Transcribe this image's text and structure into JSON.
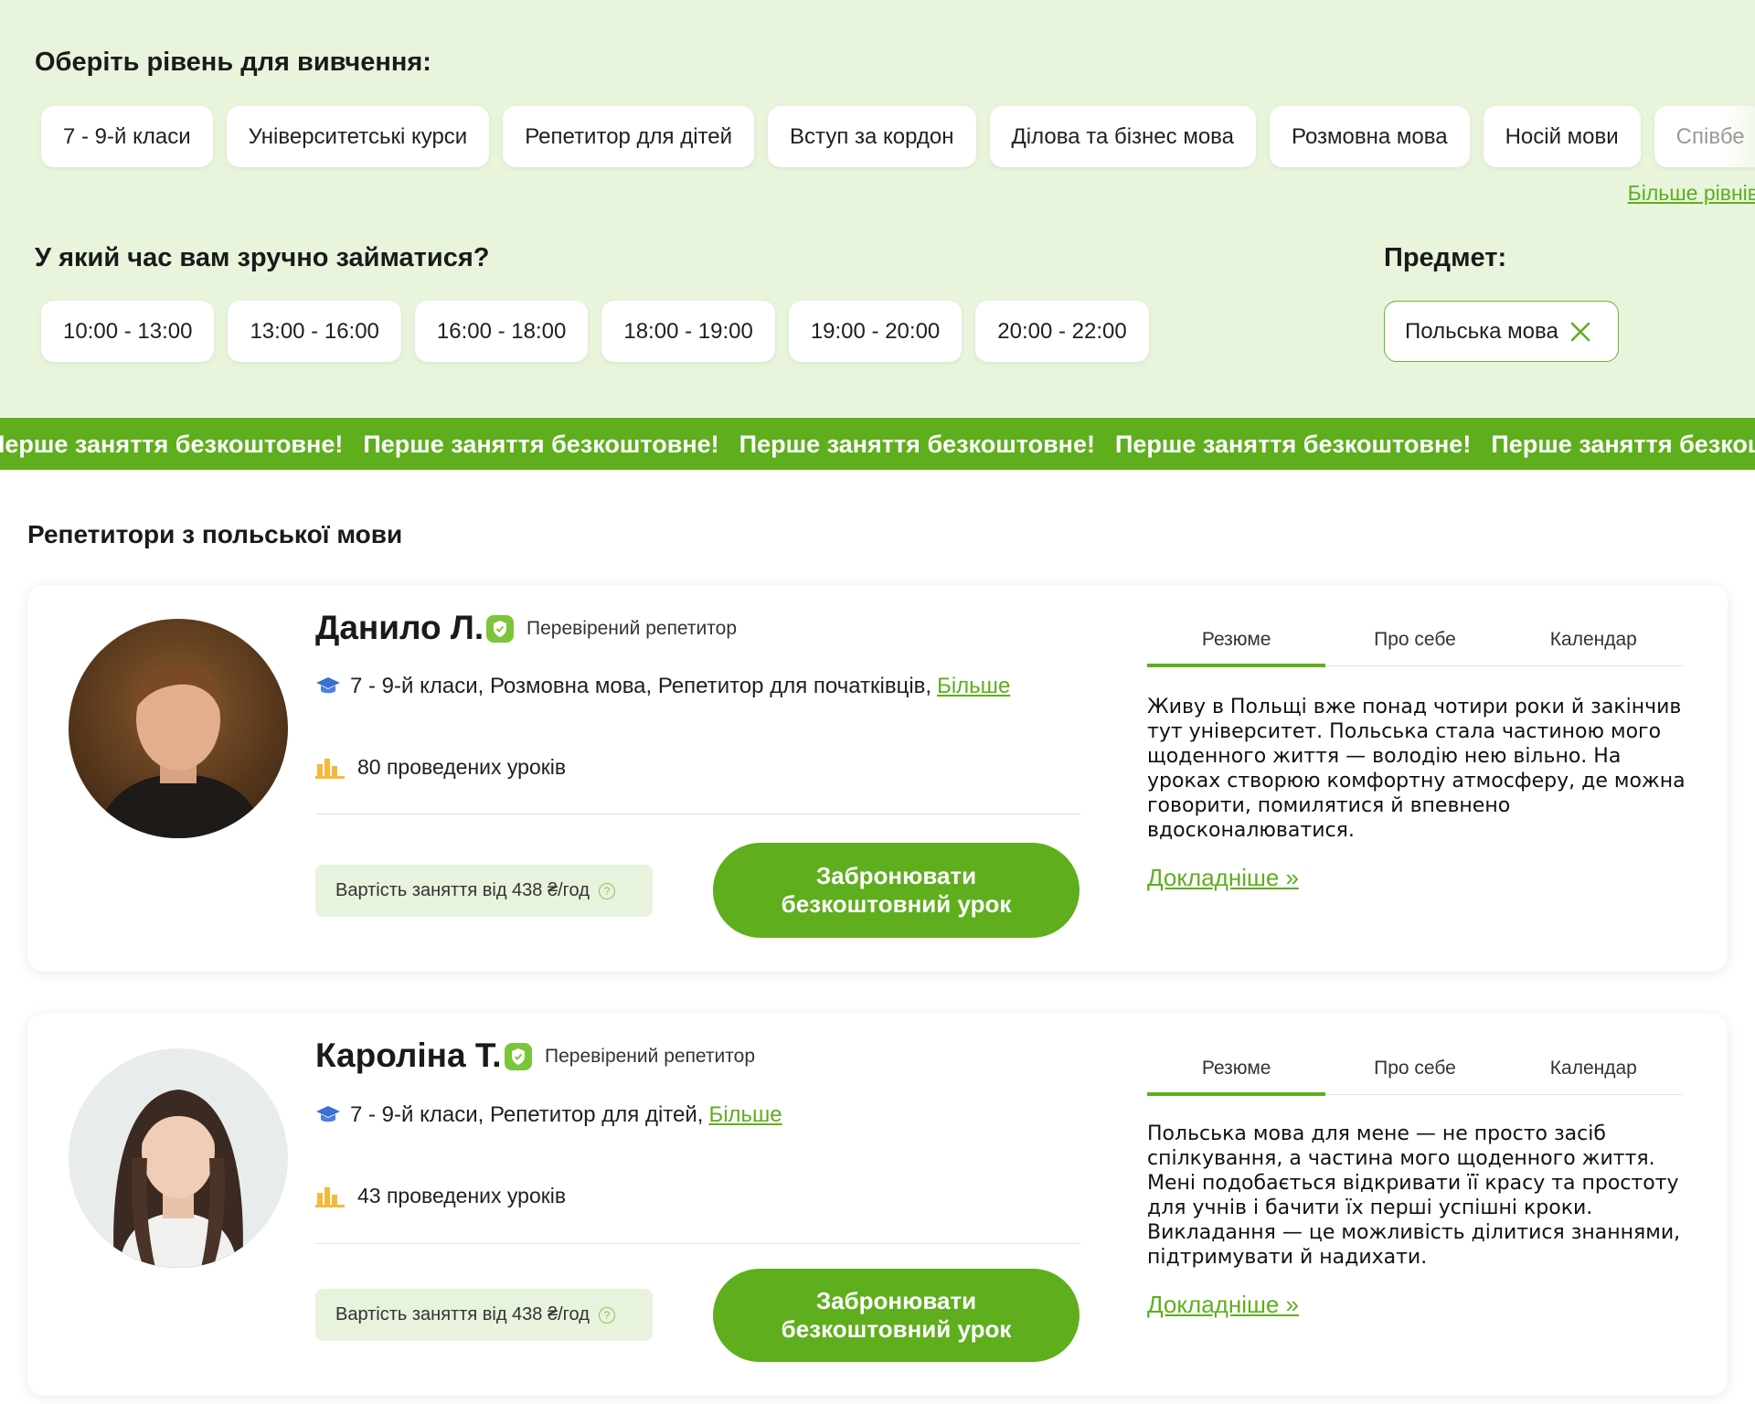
{
  "filters": {
    "level_heading": "Оберіть рівень для вивчення:",
    "levels": [
      "7 - 9-й класи",
      "Університетські курси",
      "Репетитор для дітей",
      "Вступ за кордон",
      "Ділова та бізнес мова",
      "Розмовна мова",
      "Носій мови",
      "Співбе"
    ],
    "more_levels": "Більше рівнів",
    "time_heading": "У який час вам зручно займатися?",
    "times": [
      "10:00 - 13:00",
      "13:00 - 16:00",
      "16:00 - 18:00",
      "18:00 - 19:00",
      "19:00 - 20:00",
      "20:00 - 22:00"
    ],
    "subject_heading": "Предмет:",
    "subject_value": "Польська мова"
  },
  "banner": {
    "items": [
      "Перше заняття безкоштовне!",
      "Перше заняття безкоштовне!",
      "Перше заняття безкоштовне!",
      "Перше заняття безкоштовне!",
      "Перше заняття безкоштовне!"
    ]
  },
  "section_title": "Репетитори з польської мови",
  "tutors": [
    {
      "name": "Данило Л.",
      "verified": "Перевірений репетитор",
      "levels": "7 - 9-й класи, Розмовна мова, Репетитор для початківців,",
      "more": "Більше",
      "lessons": "80 проведених уроків",
      "price": "Вартість заняття від 438 ₴/год",
      "book": "Забронювати безкоштовний урок",
      "tabs": [
        "Резюме",
        "Про себе",
        "Календар"
      ],
      "about": "Живу в Польщі вже понад чотири роки й закінчив тут університет. Польська стала частиною мого щоденного життя — володію нею вільно. На уроках створюю комфортну атмосферу, де можна говорити, помилятися й впевнено вдосконалюватися.",
      "details": "Докладніше »"
    },
    {
      "name": "Кароліна Т.",
      "verified": "Перевірений репетитор",
      "levels": "7 - 9-й класи, Репетитор для дітей,",
      "more": "Більше",
      "lessons": "43 проведених уроків",
      "price": "Вартість заняття від 438 ₴/год",
      "book": "Забронювати безкоштовний урок",
      "tabs": [
        "Резюме",
        "Про себе",
        "Календар"
      ],
      "about": "Польська мова для мене — не просто засіб спілкування, а частина мого щоденного життя. Мені подобається відкривати її красу та простоту для учнів і бачити їх перші успішні кроки. Викладання — це можливість ділитися знаннями, підтримувати й надихати.",
      "details": "Докладніше »"
    }
  ],
  "colors": {
    "accent": "#5fae1e",
    "filter_bg": "#e8f4dc",
    "price_bg": "#e7f3dc"
  }
}
